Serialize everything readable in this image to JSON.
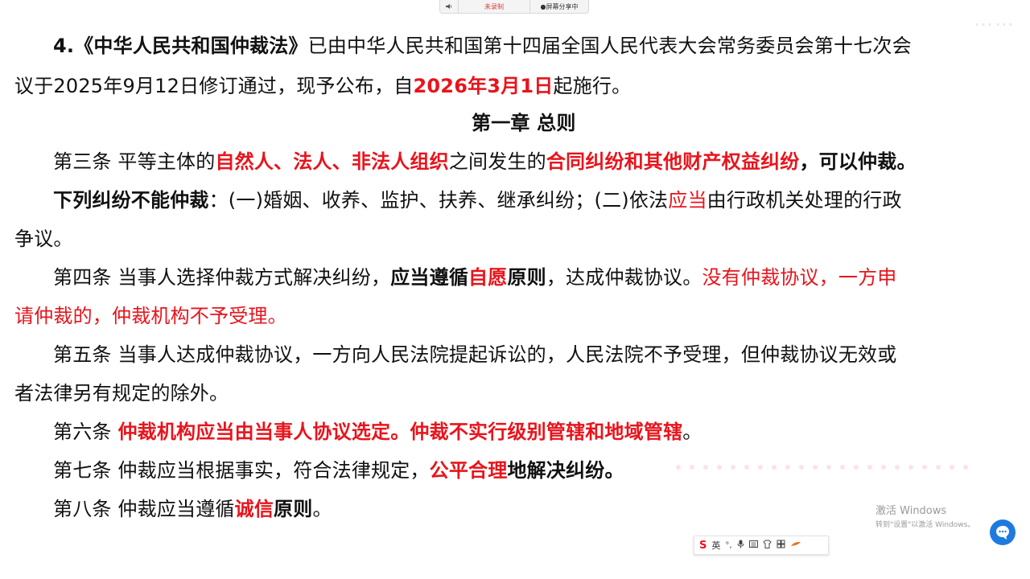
{
  "topbar": {
    "mic_icon": "speaker-icon",
    "record_label": "未录制",
    "share_label": "●屏幕分享中"
  },
  "header_faint": "……",
  "document": {
    "line1": {
      "num": "4.",
      "law_title": "《中华人民共和国仲裁法》",
      "rest": "已由中华人民共和国第十四届全国人民代表大会常务委员会第十七次会"
    },
    "line2": {
      "text_a": "议于2025年9月12日修订通过，现予公布，自",
      "date": "2026年3月1日",
      "text_b": "起施行。"
    },
    "chapter": "第一章 总则",
    "art3": {
      "a": "第三条 平等主体的",
      "b": "自然人、法人、非法人组织",
      "c": "之间发生的",
      "d": "合同纠纷和其他财产权益纠纷",
      "e": "，可以仲裁。"
    },
    "art3_exclusion": {
      "a": "下列纠纷不能仲裁",
      "b": "：(一)婚姻、收养、监护、扶养、继承纠纷；(二)依法",
      "c": "应当",
      "d": "由行政机关处理的行政"
    },
    "art3_exclusion_end": "争议。",
    "art4": {
      "a": "第四条 当事人选择仲裁方式解决纠纷，",
      "b": "应当遵循",
      "c": "自愿",
      "d": "原则",
      "e": "，达成仲裁协议。",
      "f": "没有仲裁协议，一方申"
    },
    "art4_end": "请仲裁的，仲裁机构不予受理。",
    "art5": "第五条 当事人达成仲裁协议，一方向人民法院提起诉讼的，人民法院不予受理，但仲裁协议无效或",
    "art5_end": "者法律另有规定的除外。",
    "art6": {
      "a": "第六条 ",
      "b": "仲裁机构应当由当事人协议选定。仲裁不实行级别管辖和地域管辖",
      "c": "。"
    },
    "art7": {
      "a": "第七条 仲裁应当根据事实，符合法律规定，",
      "b": "公平合理",
      "c": "地解决纠纷。"
    },
    "art8": {
      "a": "第八条 仲裁应当遵循",
      "b": "诚信",
      "c": "原则",
      "d": "。"
    }
  },
  "windows_watermark": {
    "line1": "激活 Windows",
    "line2": "转到\"设置\"以激活 Windows。"
  },
  "ime_toolbar": {
    "logo": "S",
    "lang": "英",
    "icons": [
      "punctuation-icon",
      "microphone-icon",
      "keyboard-icon",
      "skin-icon",
      "grid-icon",
      "brush-icon"
    ]
  },
  "colors": {
    "accent_red": "#e8141c",
    "chat_blue": "#1f7ae0"
  }
}
